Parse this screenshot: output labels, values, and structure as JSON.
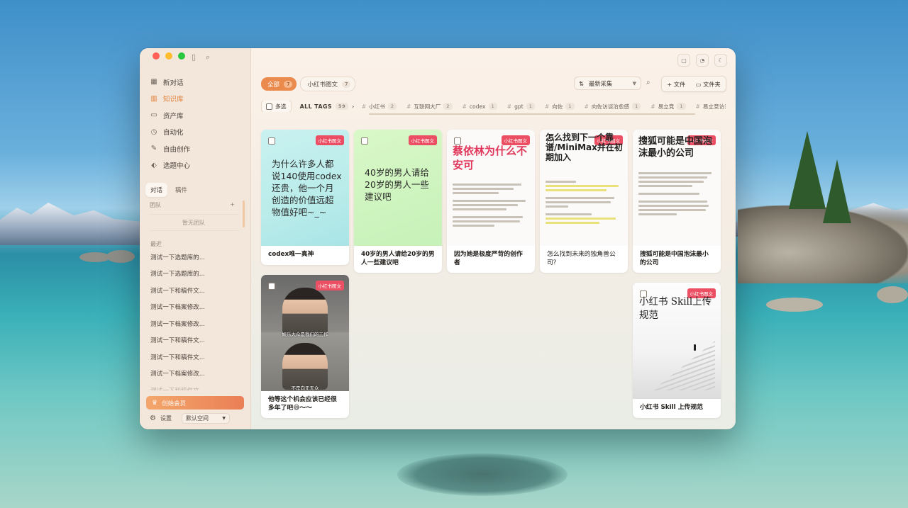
{
  "sidebar": {
    "nav": [
      {
        "label": "新对话",
        "icon": "chat-new-icon"
      },
      {
        "label": "知识库",
        "icon": "book-icon",
        "active": true
      },
      {
        "label": "资产库",
        "icon": "folder-icon"
      },
      {
        "label": "自动化",
        "icon": "clock-icon"
      },
      {
        "label": "自由创作",
        "icon": "pen-icon"
      },
      {
        "label": "选题中心",
        "icon": "topic-icon"
      }
    ],
    "subtabs": [
      "对话",
      "稿件"
    ],
    "team_label": "团队",
    "team_add": "+",
    "team_empty": "暂无团队",
    "recent_label": "最近",
    "recent": [
      "测试一下选题库的...",
      "测试一下选题库的...",
      "测试一下和稿件文...",
      "测试一下档案修改...",
      "测试一下档案修改...",
      "测试一下和稿件文...",
      "测试一下和稿件文...",
      "测试一下档案修改...",
      "测试一下和稿件文..."
    ],
    "member_button": "创始会员",
    "settings_label": "设置",
    "space_select": "默认空间"
  },
  "filters": [
    {
      "label": "全部",
      "count": "7",
      "active": true
    },
    {
      "label": "小红书图文",
      "count": "7",
      "active": false
    }
  ],
  "sort": {
    "label": "最新采集"
  },
  "actions": {
    "file": "文件",
    "folder": "文件夹",
    "plus": "+"
  },
  "tagbar": {
    "multi": "多选",
    "all_tags": "ALL TAGS",
    "all_count": "59",
    "tags": [
      {
        "name": "小红书",
        "count": "2"
      },
      {
        "name": "互联网大厂",
        "count": "2"
      },
      {
        "name": "codex",
        "count": "1"
      },
      {
        "name": "gpt",
        "count": "1"
      },
      {
        "name": "向佐",
        "count": "1"
      },
      {
        "name": "向佐访谈治愈感",
        "count": "1"
      },
      {
        "name": "易立竞",
        "count": "1"
      },
      {
        "name": "易立竞访谈",
        "count": ""
      }
    ]
  },
  "cards": [
    {
      "badge": "小红书图文",
      "cover": "为什么许多人都说140使用codex还贵，他一个月创造的价值远超物值好吧~_~",
      "caption": "codex唯一真神"
    },
    {
      "badge": "小红书图文",
      "cover": "40岁的男人请给20岁的男人一些建议吧",
      "caption": "40岁的男人请给20岁的男人一些建议吧"
    },
    {
      "badge": "小红书图文",
      "cover": "蔡依林为什么不安可",
      "caption": "因为她是极度严苛的创作者"
    },
    {
      "badge": "小红书图文",
      "cover": "怎么找到下一个靠谱/MiniMax并在初期加入",
      "caption": "怎么找到未来的独角兽公司？"
    },
    {
      "badge": "小红书图文",
      "cover": "搜狐可能是中国泡沫最小的公司",
      "caption": "搜狐可能是中国泡沫最小的公司"
    },
    {
      "badge": "小红书图文",
      "cover_sub1": "娱乐大众是我们的工作",
      "cover_sub2": "不是向无无众",
      "caption": "他等这个机会应该已经很多年了吧😅～～"
    },
    {
      "badge": "小红书图文",
      "cover": "小红书 Skill上传规范",
      "caption": "小红书 Skill 上传规范"
    }
  ],
  "colors": {
    "accent": "#ea8a4c",
    "badge": "#ec4f63",
    "active_nav": "#e0813b"
  }
}
